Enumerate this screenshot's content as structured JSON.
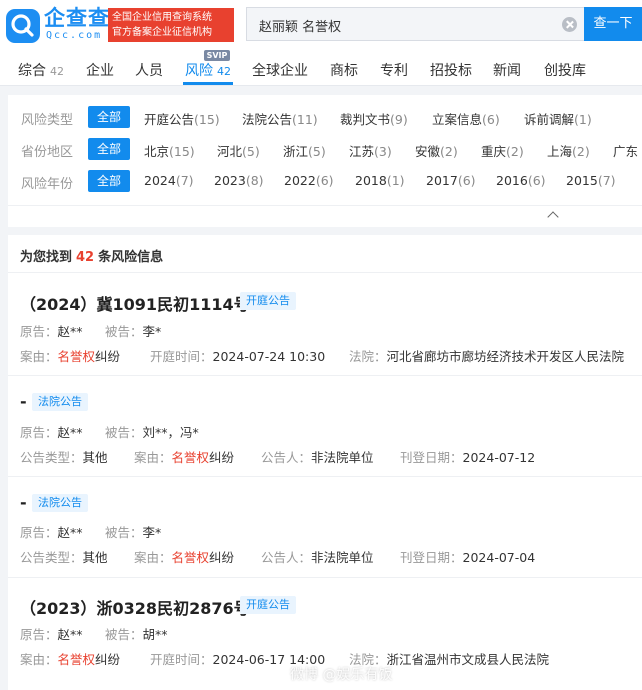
{
  "header": {
    "logo_text": "企查查",
    "logo_domain": "Qcc.com",
    "slogan_line1": "全国企业信用查询系统",
    "slogan_line2": "官方备案企业征信机构",
    "search_value": "赵丽颖 名誉权",
    "search_button": "查一下"
  },
  "tabs": [
    {
      "label": "综合",
      "count": "42"
    },
    {
      "label": "企业",
      "count": ""
    },
    {
      "label": "人员",
      "count": ""
    },
    {
      "label": "风险",
      "count": "42",
      "badge": "SVIP"
    },
    {
      "label": "全球企业",
      "count": ""
    },
    {
      "label": "商标",
      "count": ""
    },
    {
      "label": "专利",
      "count": ""
    },
    {
      "label": "招投标",
      "count": ""
    },
    {
      "label": "新闻",
      "count": ""
    },
    {
      "label": "创投库",
      "count": ""
    }
  ],
  "filters": {
    "risk_type": {
      "label": "风险类型",
      "all": "全部",
      "options": [
        {
          "name": "开庭公告",
          "count": "(15)"
        },
        {
          "name": "法院公告",
          "count": "(11)"
        },
        {
          "name": "裁判文书",
          "count": "(9)"
        },
        {
          "name": "立案信息",
          "count": "(6)"
        },
        {
          "name": "诉前调解",
          "count": "(1)"
        }
      ]
    },
    "region": {
      "label": "省份地区",
      "all": "全部",
      "options": [
        {
          "name": "北京",
          "count": "(15)"
        },
        {
          "name": "河北",
          "count": "(5)"
        },
        {
          "name": "浙江",
          "count": "(5)"
        },
        {
          "name": "江苏",
          "count": "(3)"
        },
        {
          "name": "安徽",
          "count": "(2)"
        },
        {
          "name": "重庆",
          "count": "(2)"
        },
        {
          "name": "上海",
          "count": "(2)"
        },
        {
          "name": "广东",
          "count": ""
        }
      ]
    },
    "year": {
      "label": "风险年份",
      "all": "全部",
      "options": [
        {
          "name": "2024",
          "count": "(7)"
        },
        {
          "name": "2023",
          "count": "(8)"
        },
        {
          "name": "2022",
          "count": "(6)"
        },
        {
          "name": "2018",
          "count": "(1)"
        },
        {
          "name": "2017",
          "count": "(6)"
        },
        {
          "name": "2016",
          "count": "(6)"
        },
        {
          "name": "2015",
          "count": "(7)"
        }
      ]
    }
  },
  "summary": {
    "prefix": "为您找到",
    "count": "42",
    "suffix": "条风险信息"
  },
  "cases": [
    {
      "title": "（2024）冀1091民初1114号",
      "tag": "开庭公告",
      "plaintiff_label": "原告：",
      "plaintiff": "赵**",
      "defendant_label": "被告：",
      "defendant": "李*",
      "cause_label": "案由：",
      "cause_hl": "名誉权",
      "cause_rest": "纠纷",
      "date_label": "开庭时间：",
      "date": "2024-07-24 10:30",
      "court_label": "法院：",
      "court": "河北省廊坊市廊坊经济技术开发区人民法院"
    },
    {
      "title": "-",
      "tag": "法院公告",
      "plaintiff_label": "原告：",
      "plaintiff": "赵**",
      "defendant_label": "被告：",
      "defendant": "刘**，冯*",
      "type_label": "公告类型：",
      "type": "其他",
      "cause_label": "案由：",
      "cause_hl": "名誉权",
      "cause_rest": "纠纷",
      "announcer_label": "公告人：",
      "announcer": "非法院单位",
      "pubdate_label": "刊登日期：",
      "pubdate": "2024-07-12"
    },
    {
      "title": "-",
      "tag": "法院公告",
      "plaintiff_label": "原告：",
      "plaintiff": "赵**",
      "defendant_label": "被告：",
      "defendant": "李*",
      "type_label": "公告类型：",
      "type": "其他",
      "cause_label": "案由：",
      "cause_hl": "名誉权",
      "cause_rest": "纠纷",
      "announcer_label": "公告人：",
      "announcer": "非法院单位",
      "pubdate_label": "刊登日期：",
      "pubdate": "2024-07-04"
    },
    {
      "title": "（2023）浙0328民初2876号",
      "tag": "开庭公告",
      "plaintiff_label": "原告：",
      "plaintiff": "赵**",
      "defendant_label": "被告：",
      "defendant": "胡**",
      "cause_label": "案由：",
      "cause_hl": "名誉权",
      "cause_rest": "纠纷",
      "date_label": "开庭时间：",
      "date": "2024-06-17 14:00",
      "court_label": "法院：",
      "court": "浙江省温州市文成县人民法院"
    }
  ],
  "watermark": "微博 @娱乐有饭"
}
